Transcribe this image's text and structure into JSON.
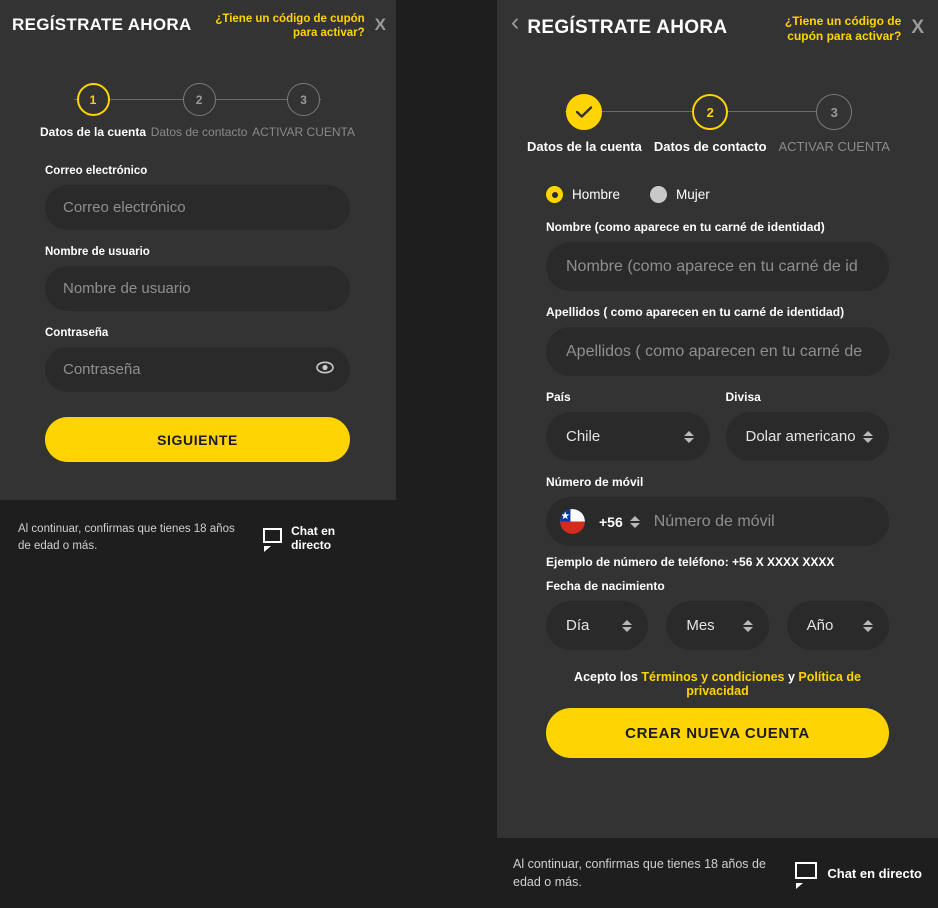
{
  "left_panel": {
    "header": {
      "title": "REGÍSTRATE AHORA",
      "coupon_link": "¿Tiene un código de cupón para activar?",
      "close_label": "X"
    },
    "stepper": {
      "steps": [
        {
          "num": "1",
          "label": "Datos de la cuenta",
          "state": "active"
        },
        {
          "num": "2",
          "label": "Datos de contacto",
          "state": "todo"
        },
        {
          "num": "3",
          "label": "ACTIVAR CUENTA",
          "state": "todo"
        }
      ]
    },
    "fields": {
      "email": {
        "label": "Correo electrónico",
        "placeholder": "Correo electrónico",
        "value": ""
      },
      "username": {
        "label": "Nombre de usuario",
        "placeholder": "Nombre de usuario",
        "value": ""
      },
      "password": {
        "label": "Contraseña",
        "placeholder": "Contraseña",
        "value": ""
      }
    },
    "submit_label": "SIGUIENTE",
    "footer": {
      "disclaimer": "Al continuar, confirmas que tienes 18 años de edad o más.",
      "chat_label": "Chat en directo"
    }
  },
  "right_panel": {
    "header": {
      "back_label": "‹",
      "title": "REGÍSTRATE AHORA",
      "coupon_link": "¿Tiene un código de cupón para activar?",
      "close_label": "X"
    },
    "stepper": {
      "steps": [
        {
          "num": "✓",
          "label": "Datos de la cuenta",
          "state": "done"
        },
        {
          "num": "2",
          "label": "Datos de contacto",
          "state": "active"
        },
        {
          "num": "3",
          "label": "ACTIVAR CUENTA",
          "state": "todo"
        }
      ]
    },
    "gender": {
      "male_label": "Hombre",
      "female_label": "Mujer",
      "selected": "Hombre"
    },
    "fields": {
      "first_name": {
        "label": "Nombre (como aparece en tu carné de identidad)",
        "placeholder": "Nombre (como aparece en tu carné de id",
        "value": ""
      },
      "last_name": {
        "label": "Apellidos ( como aparecen en tu carné de identidad)",
        "placeholder": "Apellidos ( como aparecen en tu carné de",
        "value": ""
      },
      "country": {
        "label": "País",
        "value": "Chile"
      },
      "currency": {
        "label": "Divisa",
        "value": "Dolar americano"
      },
      "mobile": {
        "label": "Número de móvil",
        "country_code": "+56",
        "placeholder": "Número de móvil",
        "value": "",
        "flag": "chile-flag-icon",
        "hint": "Ejemplo de número de teléfono: +56 X XXXX XXXX"
      },
      "birth_date": {
        "label": "Fecha de nacimiento",
        "day": "Día",
        "month": "Mes",
        "year": "Año"
      }
    },
    "terms": {
      "prefix": "Acepto los ",
      "terms_link": "Términos y condiciones",
      "conjunction": " y ",
      "privacy_link": "Política de privacidad"
    },
    "submit_label": "CREAR NUEVA CUENTA",
    "footer": {
      "disclaimer": "Al continuar, confirmas que tienes 18 años de edad o más.",
      "chat_label": "Chat en directo"
    }
  },
  "theme": {
    "accent": "#ffd400",
    "card_bg": "#333333",
    "page_bg": "#1e1e1e",
    "input_bg": "#2a2a2a"
  }
}
